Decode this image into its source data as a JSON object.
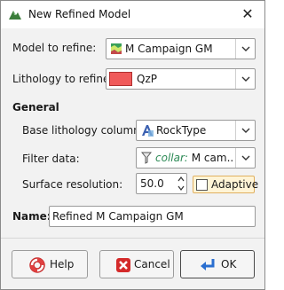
{
  "window": {
    "title": "New Refined Model",
    "close_label": "✕"
  },
  "form": {
    "model_label": "Model to refine:",
    "model_value": "M Campaign GM",
    "lithology_label": "Lithology to refine:",
    "lithology_value": "QzP",
    "lithology_color": "#f05a5a",
    "general_heading": "General",
    "base_label": "Base lithology column:",
    "base_value": "RockType",
    "filter_label": "Filter data:",
    "filter_prefix": "collar:",
    "filter_value": "M cam...",
    "resolution_label": "Surface resolution:",
    "resolution_value": "50.0",
    "adaptive_label": "Adaptive",
    "adaptive_checked": false,
    "name_label": "Name:",
    "name_value": "Refined M Campaign GM"
  },
  "buttons": {
    "help": "Help",
    "cancel": "Cancel",
    "ok": "OK"
  },
  "colors": {
    "accent_filter": "#2e8b57",
    "adaptive_highlight": "#fff4d6"
  }
}
